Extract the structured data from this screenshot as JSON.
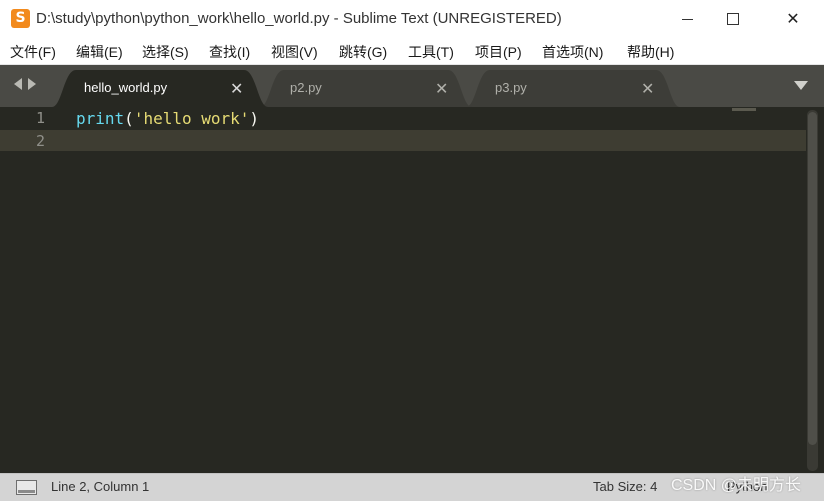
{
  "window": {
    "title": "D:\\study\\python\\python_work\\hello_world.py - Sublime Text (UNREGISTERED)",
    "app_icon_letter": "S",
    "close_symbol": "✕"
  },
  "menu": [
    "文件(F)",
    "编辑(E)",
    "选择(S)",
    "查找(I)",
    "视图(V)",
    "跳转(G)",
    "工具(T)",
    "项目(P)",
    "首选项(N)",
    "帮助(H)"
  ],
  "tabs": [
    {
      "label": "hello_world.py",
      "active": true,
      "close": "✕"
    },
    {
      "label": "p2.py",
      "active": false,
      "close": "✕"
    },
    {
      "label": "p3.py",
      "active": false,
      "close": "✕"
    }
  ],
  "editor": {
    "line_numbers": [
      "1",
      "2"
    ],
    "current_line": 2,
    "code_tokens": {
      "fn": "print",
      "open": "(",
      "str": "'hello work'",
      "close": ")"
    }
  },
  "status": {
    "position": "Line 2, Column 1",
    "tab_size": "Tab Size: 4",
    "syntax": "Python"
  },
  "watermark": "CSDN @未明方长",
  "colors": {
    "background": "#272822",
    "function": "#66d9ef",
    "string": "#e6db74",
    "app_icon": "#f28a1d"
  }
}
